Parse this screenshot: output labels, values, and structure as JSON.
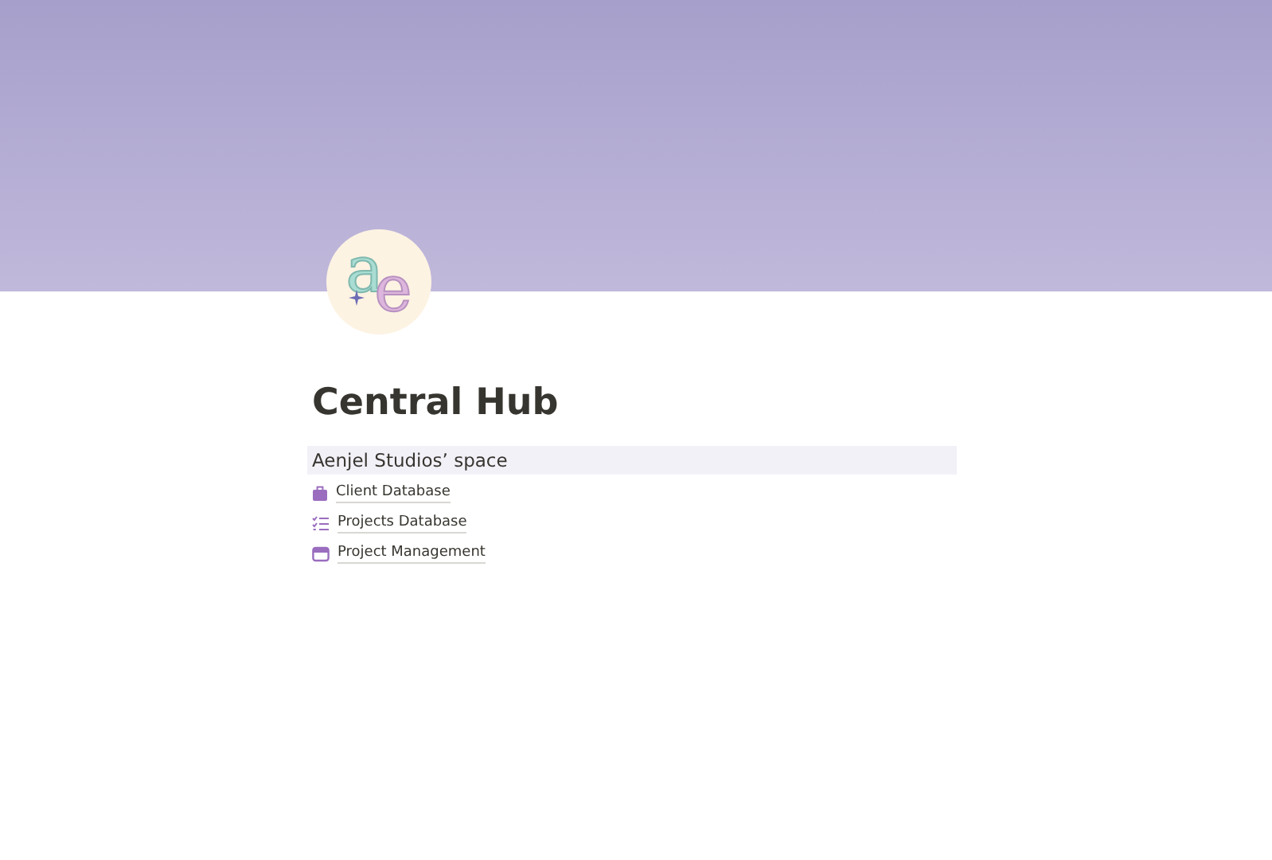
{
  "page_icon": {
    "letters": [
      "a",
      "e"
    ]
  },
  "title": "Central Hub",
  "section": {
    "heading": "Aenjel Studios’ space",
    "links": [
      {
        "kind": "briefcase",
        "label": "Client Database"
      },
      {
        "kind": "checklist",
        "label": "Projects Database"
      },
      {
        "kind": "window",
        "label": "Project Management"
      }
    ]
  }
}
